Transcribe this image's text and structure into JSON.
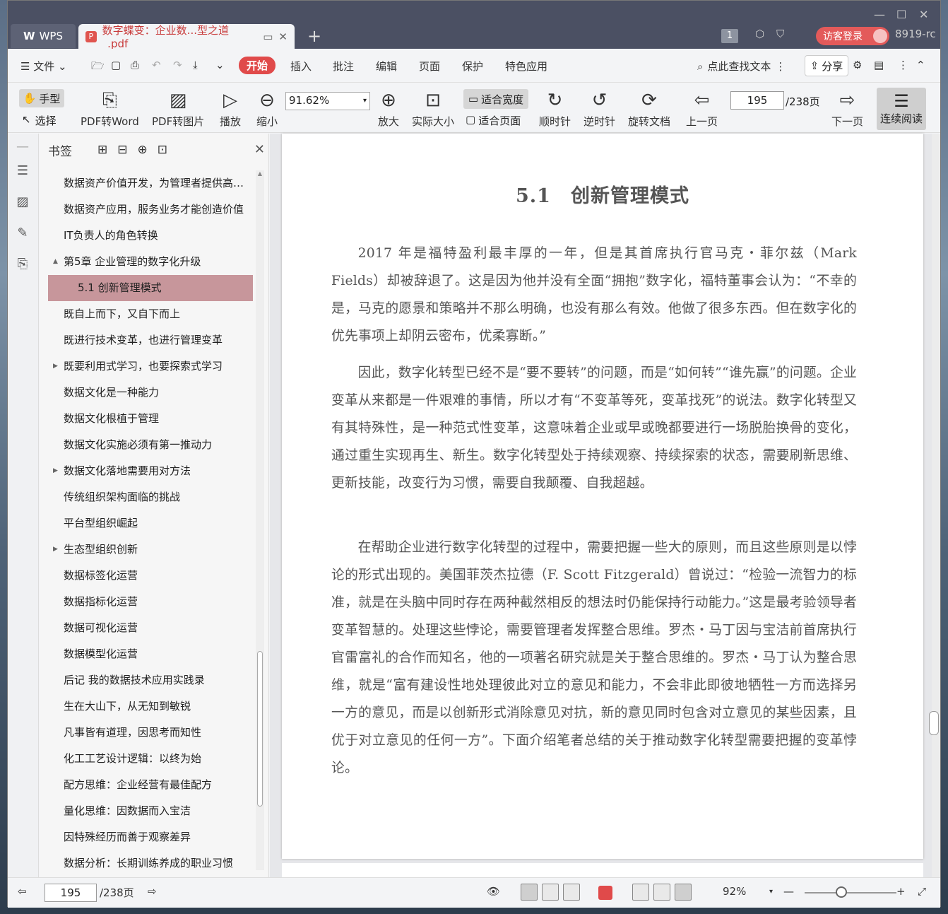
{
  "titlebar": {
    "app_name": "WPS",
    "doc_tab": "数字蝶变：企业数...型之道_.pdf",
    "badge": "1",
    "login": "访客登录",
    "user": "8919-rc"
  },
  "menu": {
    "file": "文件",
    "items": [
      "开始",
      "插入",
      "批注",
      "编辑",
      "页面",
      "保护",
      "特色应用"
    ],
    "search": "点此查找文本",
    "share": "分享"
  },
  "toolbar": {
    "hand": "手型",
    "select": "选择",
    "pdf_to_word": "PDF转Word",
    "pdf_to_image": "PDF转图片",
    "play": "播放",
    "zoom_out": "缩小",
    "zoom_value": "91.62%",
    "zoom_in": "放大",
    "actual_size": "实际大小",
    "fit_width": "适合宽度",
    "fit_page": "适合页面",
    "clockwise": "顺时针",
    "counterclockwise": "逆时针",
    "rotate_doc": "旋转文档",
    "prev_page": "上一页",
    "page_current": "195",
    "page_total": "/238页",
    "next_page": "下一页",
    "continuous": "连续阅读"
  },
  "bookmarks": {
    "title": "书签",
    "items": [
      {
        "label": "数据资产价值开发，为管理者提供高效...",
        "level": 1
      },
      {
        "label": "数据资产应用，服务业务才能创造价值",
        "level": 1
      },
      {
        "label": "IT负责人的角色转换",
        "level": 1
      },
      {
        "label": "第5章 企业管理的数字化升级",
        "level": 1,
        "expander": "▲"
      },
      {
        "label": "5.1 创新管理模式",
        "level": 2,
        "active": true
      },
      {
        "label": "既自上而下，又自下而上",
        "level": 1
      },
      {
        "label": "既进行技术变革，也进行管理变革",
        "level": 1
      },
      {
        "label": "既要利用式学习，也要探索式学习",
        "level": 1,
        "expander": "▶"
      },
      {
        "label": "数据文化是一种能力",
        "level": 1
      },
      {
        "label": "数据文化根植于管理",
        "level": 1
      },
      {
        "label": "数据文化实施必须有第一推动力",
        "level": 1
      },
      {
        "label": "数据文化落地需要用对方法",
        "level": 1,
        "expander": "▶"
      },
      {
        "label": "传统组织架构面临的挑战",
        "level": 1
      },
      {
        "label": "平台型组织崛起",
        "level": 1
      },
      {
        "label": "生态型组织创新",
        "level": 1,
        "expander": "▶"
      },
      {
        "label": "数据标签化运营",
        "level": 1
      },
      {
        "label": "数据指标化运营",
        "level": 1
      },
      {
        "label": "数据可视化运营",
        "level": 1
      },
      {
        "label": "数据模型化运营",
        "level": 1
      },
      {
        "label": "后记 我的数据技术应用实践录",
        "level": 1
      },
      {
        "label": "生在大山下，从无知到敏锐",
        "level": 1
      },
      {
        "label": "凡事皆有道理，因思考而知性",
        "level": 1
      },
      {
        "label": "化工工艺设计逻辑：以终为始",
        "level": 1
      },
      {
        "label": "配方思维：企业经营有最佳配方",
        "level": 1
      },
      {
        "label": "量化思维：因数据而入宝洁",
        "level": 1
      },
      {
        "label": "因特殊经历而善于观察差异",
        "level": 1
      },
      {
        "label": "数据分析：长期训练养成的职业习惯",
        "level": 1
      }
    ]
  },
  "document": {
    "heading": "5.1　创新管理模式",
    "paragraphs": [
      "2017 年是福特盈利最丰厚的一年，但是其首席执行官马克・菲尔兹（Mark Fields）却被辞退了。这是因为他并没有全面“拥抱”数字化，福特董事会认为：“不幸的是，马克的愿景和策略并不那么明确，也没有那么有效。他做了很多东西。但在数字化的优先事项上却阴云密布，优柔寡断。”",
      "因此，数字化转型已经不是“要不要转”的问题，而是“如何转”“谁先赢”的问题。企业变革从来都是一件艰难的事情，所以才有“不变革等死，变革找死”的说法。数字化转型又有其特殊性，是一种范式性变革，这意味着企业或早或晚都要进行一场脱胎换骨的变化，通过重生实现再生、新生。数字化转型处于持续观察、持续探索的状态，需要刷新思维、更新技能，改变行为习惯，需要自我颠覆、自我超越。",
      "在帮助企业进行数字化转型的过程中，需要把握一些大的原则，而且这些原则是以悖论的形式出现的。美国菲茨杰拉德（F. Scott Fitzgerald）曾说过：“检验一流智力的标准，就是在头脑中同时存在两种截然相反的想法时仍能保持行动能力。”这是最考验领导者变革智慧的。处理这些悖论，需要管理者发挥整合思维。罗杰・马丁因与宝洁前首席执行官雷富礼的合作而知名，他的一项著名研究就是关于整合思维的。罗杰・马丁认为整合思维，就是“富有建设性地处理彼此对立的意见和能力，不会非此即彼地牺牲一方而选择另一方的意见，而是以创新形式消除意见对抗，新的意见同时包含对立意见的某些因素，且优于对立意见的任何一方”。下面介绍笔者总结的关于推动数字化转型需要把握的变革悖论。"
    ]
  },
  "status": {
    "page_current": "195",
    "page_total": "/238页",
    "zoom": "92%"
  },
  "colors": {
    "accent": "#e04a4a",
    "titlebar": "#4b5063",
    "bookmark_active": "#c7969b"
  }
}
